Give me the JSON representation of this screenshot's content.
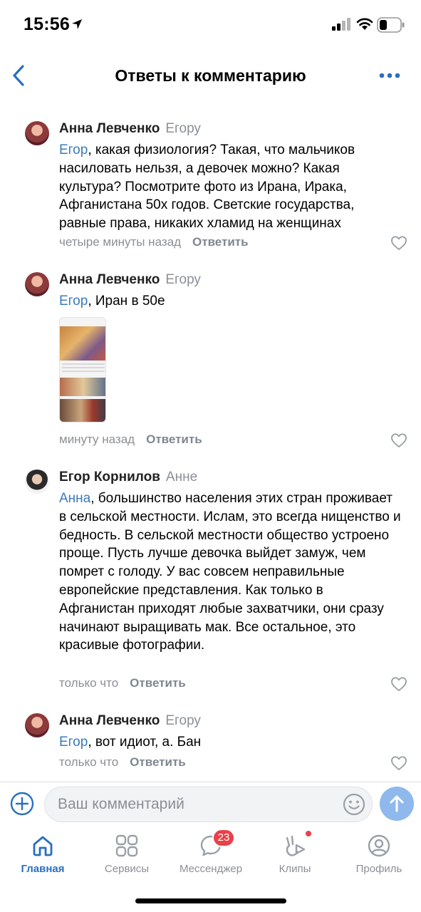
{
  "status_bar": {
    "time": "15:56"
  },
  "header": {
    "title": "Ответы к комментарию"
  },
  "comments": [
    {
      "author": "Анна Левченко",
      "reply_to": "Егору",
      "mention": "Егор",
      "text": ", какая физиология? Такая, что мальчиков насиловать нельзя, а девочек можно? Какая культура? Посмотрите фото из Ирана, Ирака, Афганистана 50х годов. Светские государства, равные права, никаких хламид на женщинах",
      "time": "четыре минуты назад",
      "reply_label": "Ответить"
    },
    {
      "author": "Анна Левченко",
      "reply_to": "Егору",
      "mention": "Егор",
      "text": ", Иран в 50е",
      "time": "минуту назад",
      "reply_label": "Ответить"
    },
    {
      "author": "Егор Корнилов",
      "reply_to": "Анне",
      "mention": "Анна",
      "text": ", большинство населения этих стран проживает в сельской местности. Ислам, это всегда нищенство и бедность. В сельской местности общество устроено проще. Пусть лучше девочка выйдет замуж, чем помрет с голоду. У вас совсем неправильные европейские представления. Как только в Афганистан приходят любые захватчики, они сразу начинают выращивать мак. Все остальное, это красивые фотографии.",
      "time": "только что",
      "reply_label": "Ответить"
    },
    {
      "author": "Анна Левченко",
      "reply_to": "Егору",
      "mention": "Егор",
      "text": ", вот идиот, а. Бан",
      "time": "только что",
      "reply_label": "Ответить"
    }
  ],
  "input": {
    "placeholder": "Ваш комментарий"
  },
  "tabs": [
    {
      "label": "Главная",
      "icon": "home-icon",
      "active": true
    },
    {
      "label": "Сервисы",
      "icon": "services-icon"
    },
    {
      "label": "Мессенджер",
      "icon": "messenger-icon",
      "badge": "23"
    },
    {
      "label": "Клипы",
      "icon": "clips-icon",
      "dot": true
    },
    {
      "label": "Профиль",
      "icon": "profile-icon"
    }
  ],
  "colors": {
    "accent": "#2a6fc0",
    "mention": "#3a7ac0",
    "badge": "#e8414a",
    "send": "#8fb9ec"
  }
}
